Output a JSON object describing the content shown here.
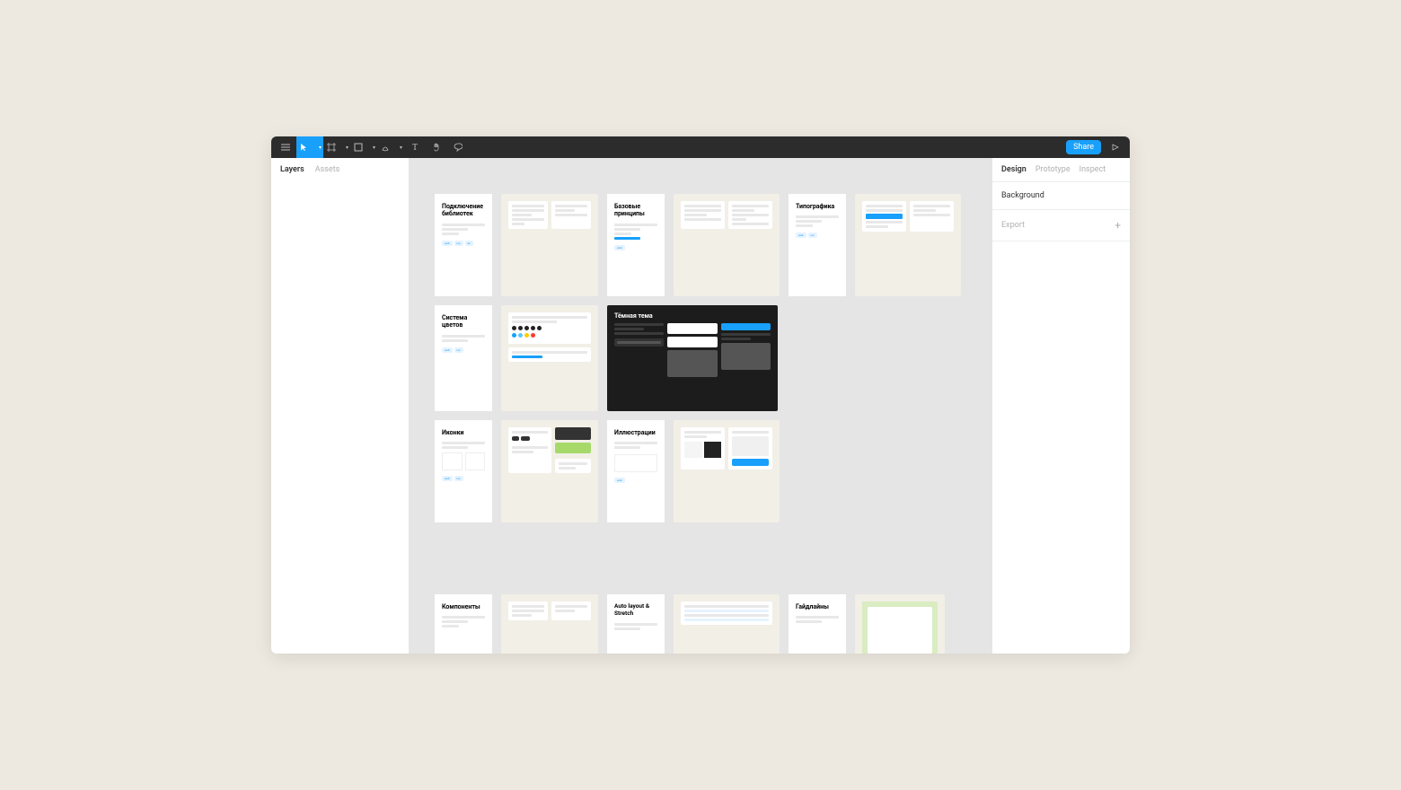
{
  "toolbar": {
    "share_label": "Share"
  },
  "left_panel": {
    "tabs": [
      "Layers",
      "Assets"
    ]
  },
  "right_panel": {
    "tabs": [
      "Design",
      "Prototype",
      "Inspect"
    ],
    "background_label": "Background",
    "export_label": "Export"
  },
  "frames": {
    "r1": {
      "c1_title": "Подключение библиотек",
      "c2_title": "Базовые принципы",
      "c3_title": "Типографика"
    },
    "r2": {
      "c1_title": "Система цветов",
      "c2_title": "Тёмная тема"
    },
    "r3": {
      "c1_title": "Иконки",
      "c2_title": "Иллюстрации"
    },
    "r4": {
      "c1_title": "Компоненты",
      "c2_title": "Auto layout & Stretch",
      "c3_title": "Гайдлайны"
    },
    "chips": [
      "web",
      "ios",
      "ax"
    ]
  }
}
